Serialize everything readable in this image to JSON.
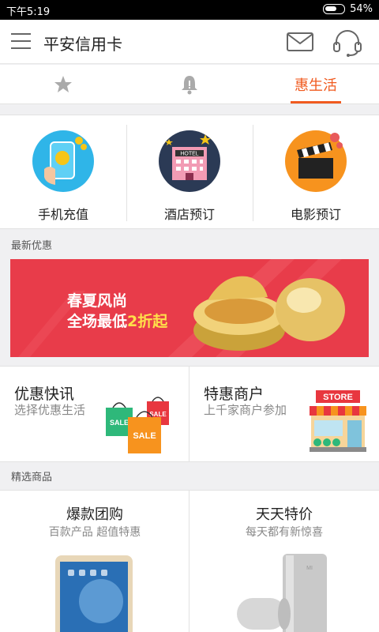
{
  "status_bar": {
    "time": "下午5:19",
    "battery": "54%"
  },
  "header": {
    "title": "平安信用卡"
  },
  "tabs": [
    {
      "icon": "star-icon",
      "label": ""
    },
    {
      "icon": "bell-icon",
      "label": ""
    },
    {
      "icon": "",
      "label": "惠生活",
      "active": true
    }
  ],
  "services": [
    {
      "label": "手机充值",
      "icon": "phone-topup-icon"
    },
    {
      "label": "酒店预订",
      "icon": "hotel-icon",
      "icon_text": "HOTEL"
    },
    {
      "label": "电影预订",
      "icon": "movie-clapper-icon"
    }
  ],
  "latest_deals": {
    "section_title": "最新优惠",
    "banner": {
      "line1": "春夏风尚",
      "line2_prefix": "全场最低",
      "line2_highlight": "2折起"
    }
  },
  "promos": [
    {
      "title": "优惠快讯",
      "subtitle": "选择优惠生活",
      "icon": "sale-bags-icon",
      "badge1": "SALE",
      "badge2": "SALE",
      "badge3": "SALE"
    },
    {
      "title": "特惠商户",
      "subtitle": "上千家商户参加",
      "icon": "store-icon",
      "sign": "STORE"
    }
  ],
  "featured": {
    "section_title": "精选商品",
    "products": [
      {
        "title": "爆款团购",
        "subtitle": "百款产品 超值特惠",
        "image": "tablet-image"
      },
      {
        "title": "天天特价",
        "subtitle": "每天都有新惊喜",
        "image": "power-bank-image"
      }
    ]
  },
  "colors": {
    "accent": "#f05a1f",
    "banner_bg": "#e83c4a",
    "banner_highlight": "#ffe04a"
  }
}
